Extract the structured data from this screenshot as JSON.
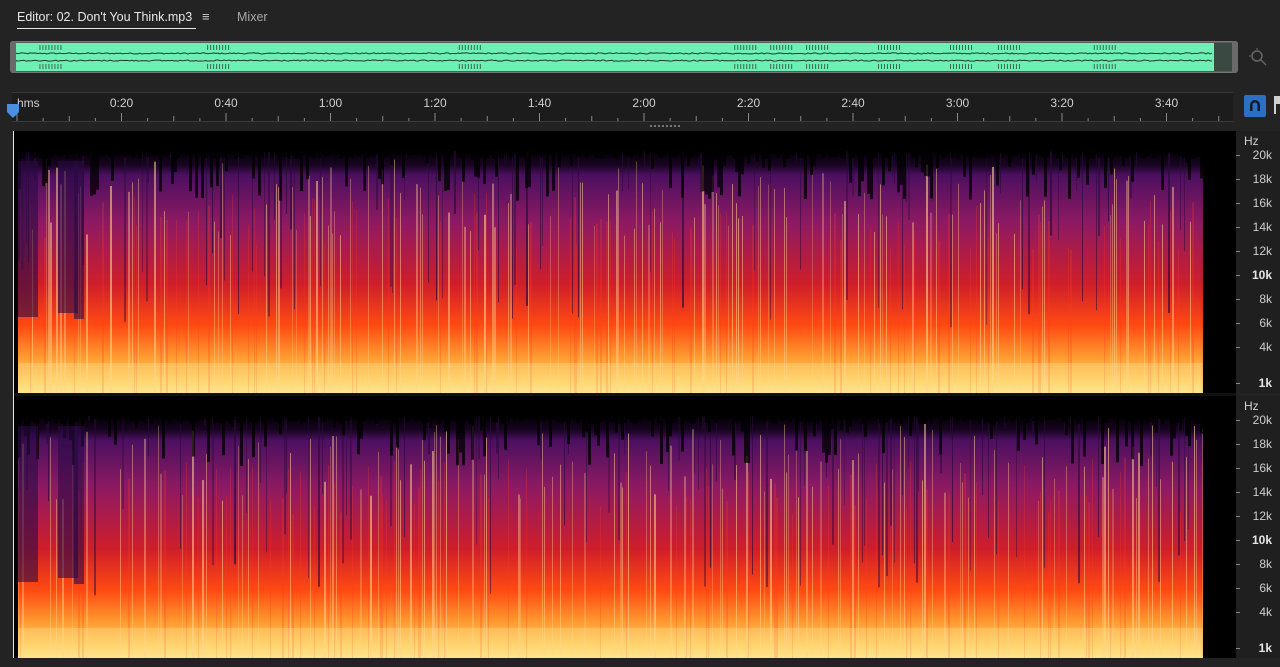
{
  "tabs": {
    "editor_label": "Editor: 02. Don't You Think.mp3",
    "menu_glyph": "≡",
    "mixer_label": "Mixer"
  },
  "overview": {
    "waveform_color": "#6ef0b4",
    "icon": "zoom-to-fit-icon"
  },
  "ruler": {
    "format": "hms",
    "labels": [
      "0:20",
      "0:40",
      "1:00",
      "1:20",
      "1:40",
      "2:00",
      "2:20",
      "2:40",
      "3:00",
      "3:20",
      "3:40"
    ],
    "label_seconds": [
      20,
      40,
      60,
      80,
      100,
      120,
      140,
      160,
      180,
      200,
      220
    ],
    "duration_seconds": 233,
    "snap_icon": "magnet-icon",
    "snap_color": "#2d6fc4",
    "playhead_color": "#4a90e2"
  },
  "spectrogram": {
    "channels": 2,
    "palette": [
      "#000000",
      "#3a0a5a",
      "#8a1a6a",
      "#d41a2a",
      "#ff5a1a",
      "#ffb040",
      "#ffe890"
    ]
  },
  "freq_axis": {
    "unit": "Hz",
    "labels": [
      {
        "text": "20k",
        "hz": 20000,
        "bold": false
      },
      {
        "text": "18k",
        "hz": 18000,
        "bold": false
      },
      {
        "text": "16k",
        "hz": 16000,
        "bold": false
      },
      {
        "text": "14k",
        "hz": 14000,
        "bold": false
      },
      {
        "text": "12k",
        "hz": 12000,
        "bold": false
      },
      {
        "text": "10k",
        "hz": 10000,
        "bold": true
      },
      {
        "text": "8k",
        "hz": 8000,
        "bold": false
      },
      {
        "text": "6k",
        "hz": 6000,
        "bold": false
      },
      {
        "text": "4k",
        "hz": 4000,
        "bold": false
      },
      {
        "text": "1k",
        "hz": 1000,
        "bold": true
      }
    ]
  }
}
